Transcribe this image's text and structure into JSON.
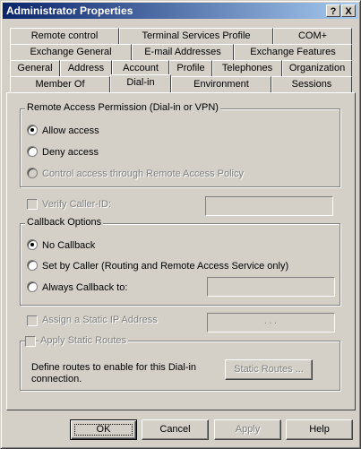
{
  "window": {
    "title": "Administrator Properties"
  },
  "titlebar_buttons": {
    "help": "?",
    "close": "X"
  },
  "tabs": {
    "row1": [
      "Remote control",
      "Terminal Services Profile",
      "COM+"
    ],
    "row2": [
      "Exchange General",
      "E-mail Addresses",
      "Exchange Features"
    ],
    "row3": [
      "General",
      "Address",
      "Account",
      "Profile",
      "Telephones",
      "Organization"
    ],
    "row4": [
      "Member Of",
      "Dial-in",
      "Environment",
      "Sessions"
    ],
    "active": "Dial-in"
  },
  "remote_access": {
    "title": "Remote Access Permission (Dial-in or VPN)",
    "allow": "Allow access",
    "deny": "Deny access",
    "policy": "Control access through Remote Access Policy",
    "selected": "allow"
  },
  "verify_caller_id": {
    "label": "Verify Caller-ID:",
    "value": ""
  },
  "callback": {
    "title": "Callback Options",
    "no_callback": "No Callback",
    "set_by_caller": "Set by Caller (Routing and Remote Access Service only)",
    "always": "Always Callback to:",
    "selected": "no_callback",
    "number": ""
  },
  "static_ip": {
    "label": "Assign a Static IP Address",
    "value": ". . ."
  },
  "static_routes": {
    "label": "Apply Static Routes",
    "description_line1": "Define routes to enable for this Dial-in",
    "description_line2": "connection.",
    "button": "Static Routes ..."
  },
  "footer": {
    "ok": "OK",
    "cancel": "Cancel",
    "apply": "Apply",
    "help": "Help"
  }
}
